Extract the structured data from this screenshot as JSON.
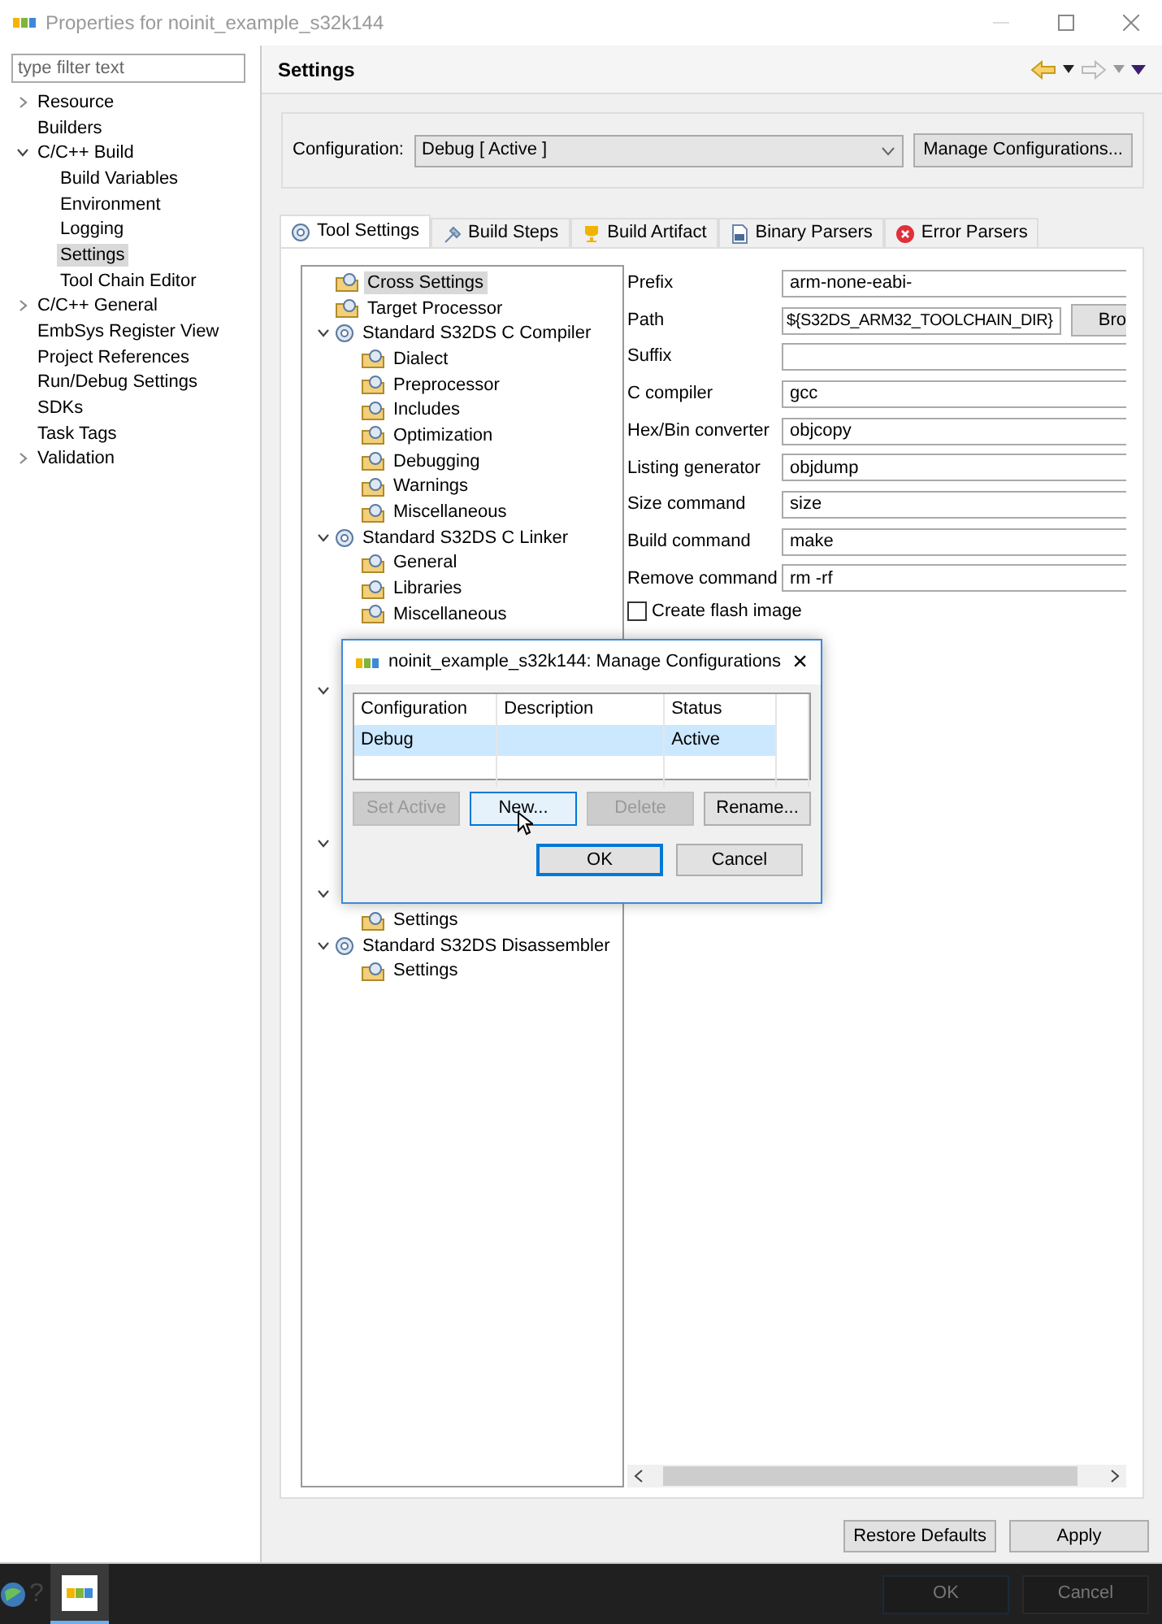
{
  "window": {
    "title": "Properties for noinit_example_s32k144"
  },
  "filter": {
    "placeholder": "type filter text"
  },
  "nav": [
    {
      "label": "Resource",
      "expanded": false,
      "selected": false
    },
    {
      "label": "Builders",
      "selected": false
    },
    {
      "label": "C/C++ Build",
      "expanded": true,
      "selected": false,
      "children": [
        {
          "label": "Build Variables",
          "selected": false
        },
        {
          "label": "Environment",
          "selected": false
        },
        {
          "label": "Logging",
          "selected": false
        },
        {
          "label": "Settings",
          "selected": true
        },
        {
          "label": "Tool Chain Editor",
          "selected": false
        }
      ]
    },
    {
      "label": "C/C++ General",
      "expanded": false,
      "selected": false
    },
    {
      "label": "EmbSys Register View",
      "selected": false
    },
    {
      "label": "Project References",
      "selected": false
    },
    {
      "label": "Run/Debug Settings",
      "selected": false
    },
    {
      "label": "SDKs",
      "selected": false
    },
    {
      "label": "Task Tags",
      "selected": false
    },
    {
      "label": "Validation",
      "expanded": false,
      "selected": false
    }
  ],
  "page_title": "Settings",
  "configuration": {
    "label": "Configuration:",
    "value": "Debug  [ Active ]",
    "button": "Manage Configurations..."
  },
  "tabs": [
    {
      "label": "Tool Settings",
      "selected": true
    },
    {
      "label": "Build Steps",
      "selected": false
    },
    {
      "label": "Build Artifact",
      "selected": false
    },
    {
      "label": "Binary Parsers",
      "selected": false
    },
    {
      "label": "Error Parsers",
      "selected": false
    }
  ],
  "tool_tree": [
    {
      "label": "Cross Settings",
      "kind": "option",
      "selected": true
    },
    {
      "label": "Target Processor",
      "kind": "option",
      "selected": false
    },
    {
      "label": "Standard S32DS C Compiler",
      "kind": "tool",
      "expanded": true,
      "selected": false,
      "children": [
        {
          "label": "Dialect",
          "kind": "option",
          "selected": false
        },
        {
          "label": "Preprocessor",
          "kind": "option",
          "selected": false
        },
        {
          "label": "Includes",
          "kind": "option",
          "selected": false
        },
        {
          "label": "Optimization",
          "kind": "option",
          "selected": false
        },
        {
          "label": "Debugging",
          "kind": "option",
          "selected": false
        },
        {
          "label": "Warnings",
          "kind": "option",
          "selected": false
        },
        {
          "label": "Miscellaneous",
          "kind": "option",
          "selected": false
        }
      ]
    },
    {
      "label": "Standard S32DS C Linker",
      "kind": "tool",
      "expanded": true,
      "selected": false,
      "children": [
        {
          "label": "General",
          "kind": "option",
          "selected": false
        },
        {
          "label": "Libraries",
          "kind": "option",
          "selected": false
        },
        {
          "label": "Miscellaneous",
          "kind": "option",
          "selected": false
        },
        {
          "kind": "covered"
        },
        {
          "kind": "covered"
        }
      ]
    },
    {
      "kind": "covered",
      "expanded": true,
      "children": [
        {
          "kind": "covered"
        },
        {
          "kind": "covered"
        },
        {
          "kind": "covered"
        },
        {
          "kind": "covered"
        },
        {
          "kind": "covered"
        }
      ]
    },
    {
      "kind": "covered",
      "expanded": true,
      "children": [
        {
          "kind": "covered"
        }
      ]
    },
    {
      "kind": "covered",
      "expanded": true,
      "children": [
        {
          "label": "Settings",
          "kind": "option",
          "selected": false
        }
      ]
    },
    {
      "label": "Standard S32DS Disassembler",
      "kind": "tool",
      "expanded": true,
      "selected": false,
      "children": [
        {
          "label": "Settings",
          "kind": "option",
          "selected": false
        }
      ]
    }
  ],
  "fields": [
    {
      "label": "Prefix",
      "value": "arm-none-eabi-"
    },
    {
      "label": "Path",
      "value": "${S32DS_ARM32_TOOLCHAIN_DIR}",
      "button": "Bro"
    },
    {
      "label": "Suffix"
    },
    {
      "label": "C compiler",
      "value": "gcc"
    },
    {
      "label": "Hex/Bin converter",
      "value": "objcopy"
    },
    {
      "label": "Listing generator",
      "value": "objdump"
    },
    {
      "label": "Size command",
      "value": "size"
    },
    {
      "label": "Build command",
      "value": "make"
    },
    {
      "label": "Remove command",
      "value": "rm -rf"
    }
  ],
  "checkboxes": [
    {
      "label": "Create flash image",
      "checked": false
    }
  ],
  "page_buttons": [
    "Restore Defaults",
    "Apply"
  ],
  "dialog": {
    "title": "noinit_example_s32k144: Manage Configurations",
    "close": "×",
    "columns": [
      "Configuration",
      "Description",
      "Status"
    ],
    "rows": [
      {
        "cells": [
          "Debug",
          "",
          "Active"
        ],
        "selected": true
      }
    ],
    "buttons": [
      {
        "label": "Set Active",
        "disabled": true,
        "focused": false
      },
      {
        "label": "New...",
        "disabled": false,
        "focused": true
      },
      {
        "label": "Delete",
        "disabled": true,
        "focused": false
      },
      {
        "label": "Rename...",
        "disabled": false,
        "focused": false
      }
    ],
    "footer_buttons": [
      {
        "label": "OK",
        "default": true
      },
      {
        "label": "Cancel",
        "default": false
      }
    ]
  },
  "taskbar": {
    "help": "?",
    "buttons": [
      "OK",
      "Cancel"
    ]
  }
}
